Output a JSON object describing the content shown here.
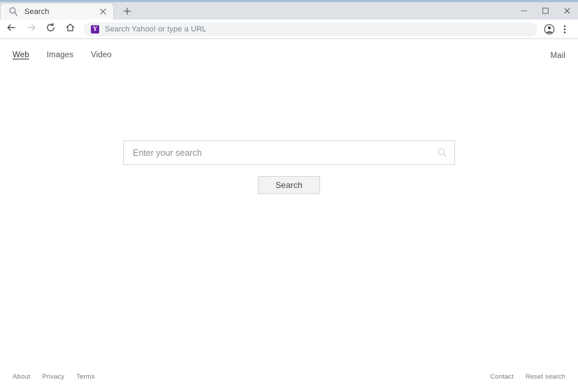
{
  "browser": {
    "tab": {
      "title": "Search",
      "favicon": "magnifier-cursor-icon",
      "close_label": "×"
    },
    "newtab_label": "+",
    "window_controls": {
      "minimize": "—",
      "maximize": "☐",
      "close": "✕"
    },
    "nav": {
      "back": "back-arrow-icon",
      "forward": "forward-arrow-icon",
      "reload": "reload-icon",
      "home": "home-icon"
    },
    "omnibox": {
      "engine_letter": "Y",
      "engine_color": "#6b21a8",
      "placeholder": "Search Yahoo! or type a URL",
      "value": ""
    },
    "toolbar_icons": {
      "profile": "profile-avatar-icon",
      "menu": "three-dot-menu-icon"
    }
  },
  "page": {
    "nav_links": [
      {
        "label": "Web",
        "active": true
      },
      {
        "label": "Images",
        "active": false
      },
      {
        "label": "Video",
        "active": false
      }
    ],
    "mail_link": "Mail",
    "search": {
      "placeholder": "Enter your search",
      "value": "",
      "icon": "magnifier-icon",
      "button_label": "Search"
    },
    "footer": {
      "left_links": [
        "About",
        "Privacy",
        "Terms"
      ],
      "right_links": [
        "Contact",
        "Reset search"
      ]
    }
  }
}
